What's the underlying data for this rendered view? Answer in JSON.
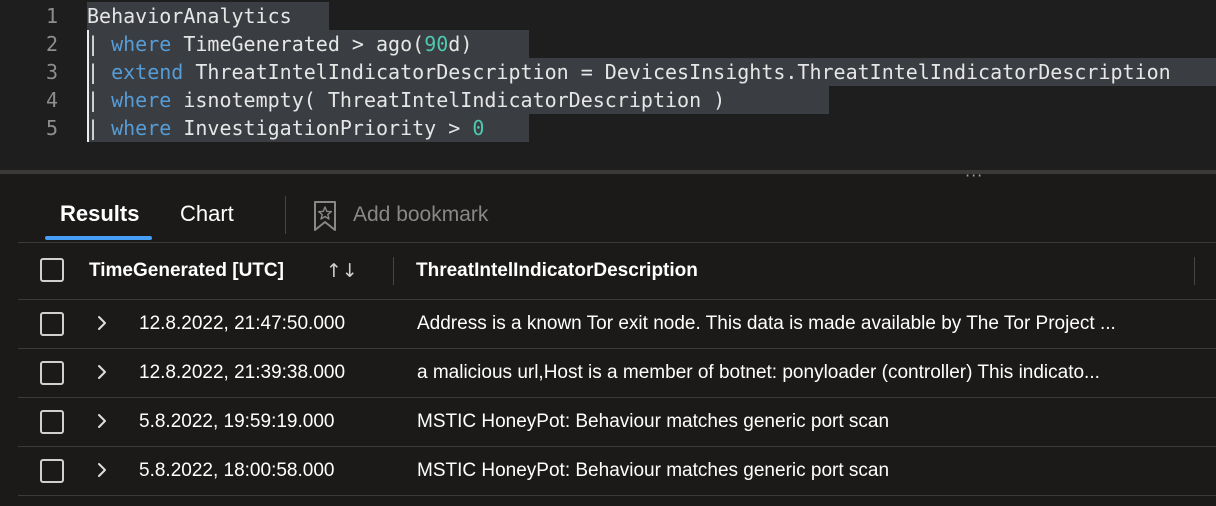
{
  "editor": {
    "lines": [
      {
        "number": "1",
        "tokens": [
          {
            "t": "BehaviorAnalytics",
            "c": "id"
          }
        ]
      },
      {
        "number": "2",
        "tokens": [
          {
            "t": "| ",
            "c": "pipe"
          },
          {
            "t": "where",
            "c": "kw"
          },
          {
            "t": " TimeGenerated > ago(",
            "c": "id"
          },
          {
            "t": "90",
            "c": "num"
          },
          {
            "t": "d)",
            "c": "id"
          }
        ]
      },
      {
        "number": "3",
        "tokens": [
          {
            "t": "| ",
            "c": "pipe"
          },
          {
            "t": "extend",
            "c": "kw"
          },
          {
            "t": " ThreatIntelIndicatorDescription = DevicesInsights.ThreatIntelIndicatorDescription",
            "c": "id"
          }
        ]
      },
      {
        "number": "4",
        "tokens": [
          {
            "t": "| ",
            "c": "pipe"
          },
          {
            "t": "where",
            "c": "kw"
          },
          {
            "t": " isnotempty( ThreatIntelIndicatorDescription )",
            "c": "id"
          }
        ]
      },
      {
        "number": "5",
        "tokens": [
          {
            "t": "| ",
            "c": "pipe"
          },
          {
            "t": "where",
            "c": "kw"
          },
          {
            "t": " InvestigationPriority > ",
            "c": "id"
          },
          {
            "t": "0",
            "c": "num"
          }
        ]
      }
    ]
  },
  "splitter": {
    "grip": "···"
  },
  "tabs": {
    "results": "Results",
    "chart": "Chart",
    "add_bookmark": "Add bookmark"
  },
  "table": {
    "columns": {
      "time": "TimeGenerated [UTC]",
      "sort_glyph": "↑↓",
      "description": "ThreatIntelIndicatorDescription"
    },
    "rows": [
      {
        "time": "12.8.2022, 21:47:50.000",
        "description": "Address is a known Tor exit node. This data is made available by The Tor Project ..."
      },
      {
        "time": "12.8.2022, 21:39:38.000",
        "description": "a malicious url,Host is a member of botnet: ponyloader (controller) This indicato..."
      },
      {
        "time": "5.8.2022, 19:59:19.000",
        "description": "MSTIC HoneyPot: Behaviour matches generic port scan"
      },
      {
        "time": "5.8.2022, 18:00:58.000",
        "description": "MSTIC HoneyPot: Behaviour matches generic port scan"
      }
    ]
  },
  "colors": {
    "background": "#1b1a19",
    "editor_background": "#1e1e1e",
    "keyword": "#569cd6",
    "number": "#4ec9b0",
    "accent": "#479ef5",
    "selection": "#3a3d41"
  }
}
